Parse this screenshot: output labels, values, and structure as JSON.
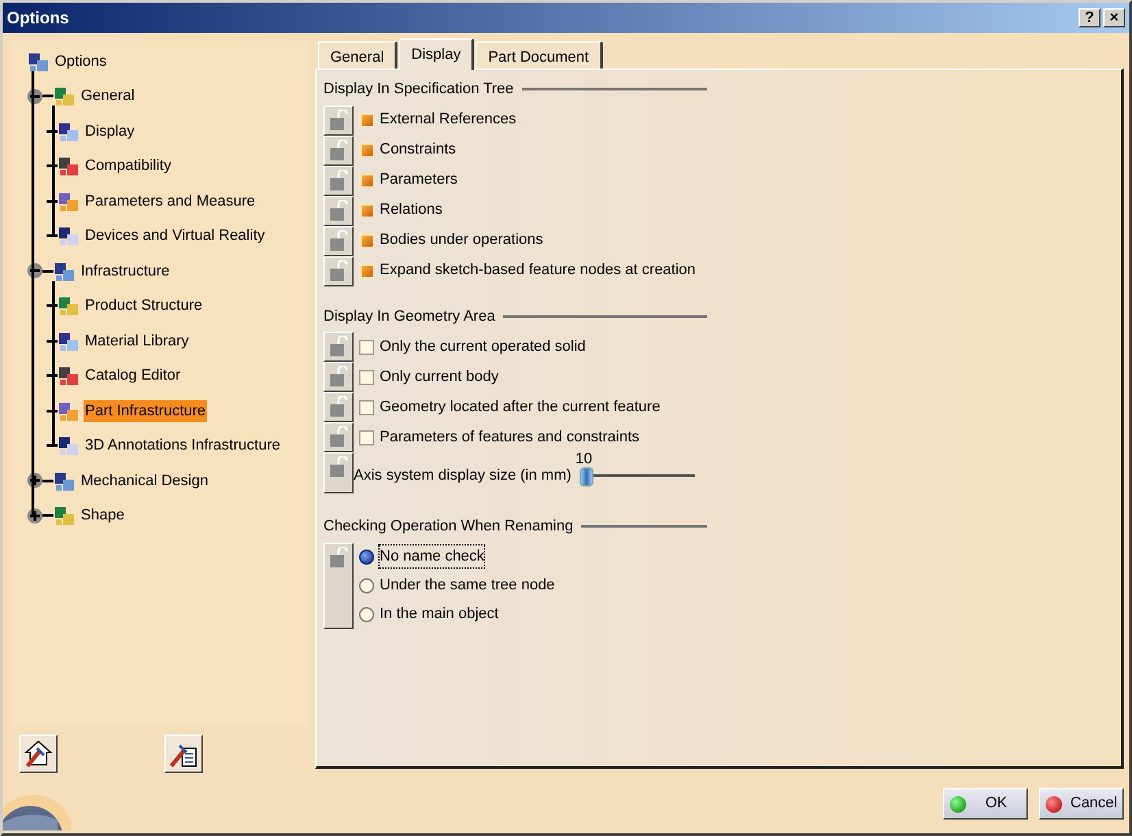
{
  "window": {
    "title": "Options",
    "help_button": "?",
    "close_button": "×"
  },
  "tree": [
    {
      "label": "Options",
      "selected": false,
      "children": [
        {
          "label": "General",
          "selected": false,
          "expanded": true,
          "children": [
            {
              "label": "Display",
              "selected": false
            },
            {
              "label": "Compatibility",
              "selected": false
            },
            {
              "label": "Parameters and Measure",
              "selected": false
            },
            {
              "label": "Devices and Virtual Reality",
              "selected": false
            }
          ]
        },
        {
          "label": "Infrastructure",
          "selected": false,
          "expanded": true,
          "children": [
            {
              "label": "Product Structure",
              "selected": false
            },
            {
              "label": "Material Library",
              "selected": false
            },
            {
              "label": "Catalog Editor",
              "selected": false
            },
            {
              "label": "Part Infrastructure",
              "selected": true
            },
            {
              "label": "3D Annotations Infrastructure",
              "selected": false
            }
          ]
        },
        {
          "label": "Mechanical Design",
          "selected": false,
          "expanded": false
        },
        {
          "label": "Shape",
          "selected": false,
          "expanded": false
        }
      ]
    }
  ],
  "tabs": [
    {
      "label": "General",
      "selected": false
    },
    {
      "label": "Display",
      "selected": true
    },
    {
      "label": "Part Document",
      "selected": false
    }
  ],
  "spec_tree": {
    "title": "Display In Specification Tree",
    "options": [
      {
        "label": "External References",
        "checked": true
      },
      {
        "label": "Constraints",
        "checked": true
      },
      {
        "label": "Parameters",
        "checked": true
      },
      {
        "label": "Relations",
        "checked": true
      },
      {
        "label": "Bodies under operations",
        "checked": true
      },
      {
        "label": "Expand sketch-based feature nodes at creation",
        "checked": true
      }
    ]
  },
  "geometry": {
    "title": "Display In Geometry Area",
    "options": [
      {
        "label": "Only the current operated solid",
        "checked": false
      },
      {
        "label": "Only current body",
        "checked": false
      },
      {
        "label": "Geometry located after the current feature",
        "checked": false
      },
      {
        "label": "Parameters of features and constraints",
        "checked": false
      }
    ],
    "axis_size": {
      "label": "Axis system display size (in mm)",
      "reading": "10",
      "level": 0.0
    }
  },
  "renaming": {
    "title": "Checking Operation When Renaming",
    "choices": [
      {
        "label": "No name check",
        "selected": true
      },
      {
        "label": "Under the same tree node",
        "selected": false
      },
      {
        "label": "In the main object",
        "selected": false
      }
    ]
  },
  "buttons": [
    {
      "label": "OK",
      "kind": "ok"
    },
    {
      "label": "Cancel",
      "kind": "cancel"
    }
  ]
}
